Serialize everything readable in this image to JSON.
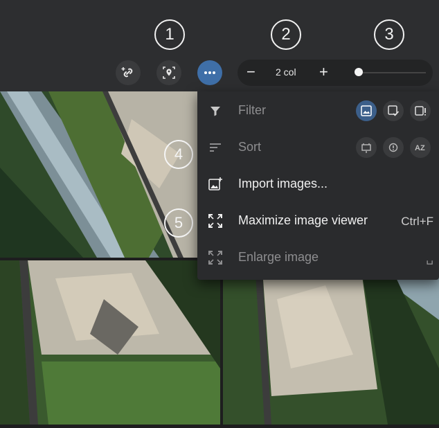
{
  "callouts": {
    "c1": "1",
    "c2": "2",
    "c3": "3",
    "c4": "4",
    "c5": "5"
  },
  "toolbar": {
    "link_icon": "add-link-icon",
    "location_icon": "location-pin-icon",
    "more_icon": "more-horizontal-icon",
    "zoom_minus": "−",
    "zoom_label": "2 col",
    "zoom_plus": "+",
    "slider_value": 0
  },
  "menu": {
    "filter": {
      "label": "Filter",
      "icon": "filter-icon",
      "chips": [
        "image-icon",
        "image-check-icon",
        "image-alert-icon"
      ]
    },
    "sort": {
      "label": "Sort",
      "icon": "sort-icon",
      "chips": [
        "sort-date-icon",
        "sort-alert-icon",
        "sort-az-icon"
      ]
    },
    "import": {
      "label": "Import images...",
      "icon": "add-image-icon"
    },
    "maximize": {
      "label": "Maximize image viewer",
      "shortcut": "Ctrl+F",
      "icon": "maximize-icon"
    },
    "enlarge": {
      "label": "Enlarge image",
      "shortcut": "␣",
      "icon": "enlarge-icon"
    }
  },
  "colors": {
    "accent": "#3f6fa8",
    "menu_bg": "#2a2b2d",
    "toolbar_bg": "#2d2e30"
  }
}
